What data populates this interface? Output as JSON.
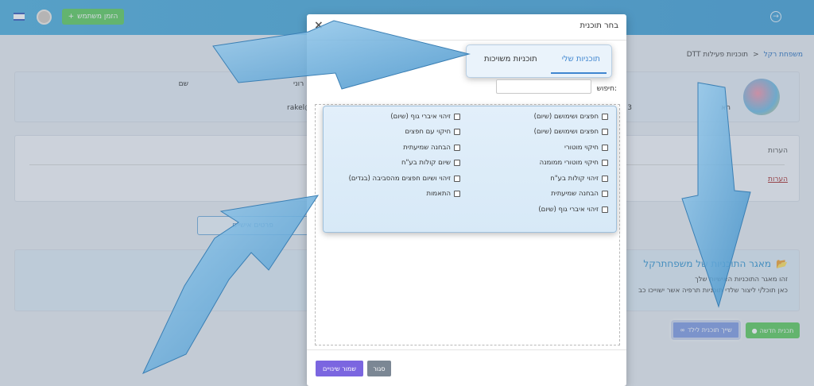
{
  "topbar": {
    "invite_label": "הזמן משתמש",
    "avatar_icon": "user-avatar",
    "flag_icon": "israel-flag-icon",
    "back_icon": "arrow-circle-icon"
  },
  "breadcrumb": {
    "root": "משפחת רקל",
    "separator": "<",
    "current": "תוכניות פעילות DTT"
  },
  "profile": {
    "line1_left": "רוני",
    "line1_right": "שם",
    "line2_left": "rakel@",
    "line2_mid": "3",
    "line2_right": "הא"
  },
  "notes": {
    "heading": "הערות",
    "link": "הערות"
  },
  "personal_button": "פרטים אישיים",
  "repo": {
    "title": "מאגר התוכניות של משפחתרקל",
    "line1": "זהו מאגר התוכניות האישיות שלך",
    "line2": "כאן תוכל/י ליצור שלדי תוכניות תרפיה אשר ישוייכו כב"
  },
  "actions": {
    "new_program": "תכנית חדשה",
    "assign_program": "שייך תוכנית לילד"
  },
  "modal": {
    "title": "בחר תוכנית",
    "close_icon": "×",
    "tabs": {
      "mine": "תוכניות שלי",
      "shared": "תוכניות משויכות"
    },
    "search_label": "חיפוש:",
    "search_value": "",
    "programs_right": [
      "חפצים ושימושם (שיום)",
      "חפצים ושימושם (שיום)",
      "חיקוי מוטורי",
      "חיקוי מוטורי ממומנה",
      "זיהוי קולות בע\"ח",
      "הבחנה שמיעתית",
      "זיהוי איברי גוף (שיום)"
    ],
    "programs_left": [
      "זיהוי איברי גוף (שיום)",
      "חיקוי עם חפצים",
      "הבחנה שמיעתית",
      "שיום קולות בע\"ח",
      "זיהוי ושיום חפצים מהסביבה (בגדים)",
      "התאמות"
    ],
    "save_label": "שמור שינויים",
    "close_label": "סגור"
  },
  "colors": {
    "topbar": "#56a9d9",
    "green": "#6fd06f",
    "purple": "#7b66e0",
    "arrow": "#5aa6d8"
  }
}
